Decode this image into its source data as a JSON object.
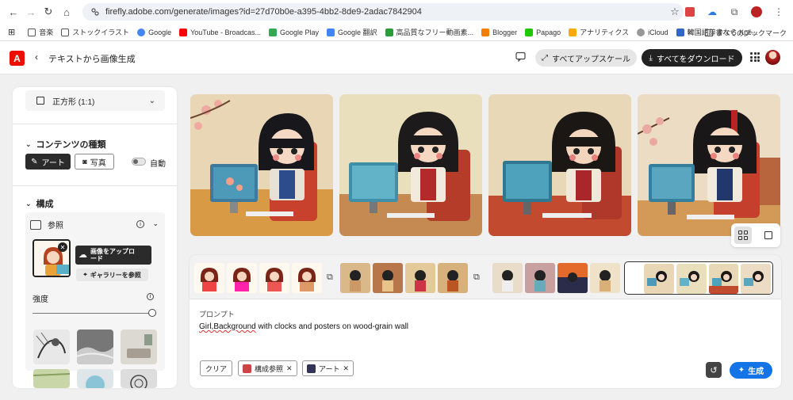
{
  "browser": {
    "url": "firefly.adobe.com/generate/images?id=27d70b0e-a395-4bb2-8de9-2adac7842904",
    "bookmarks": [
      {
        "label": "音楽",
        "color": "#777"
      },
      {
        "label": "ストックイラスト",
        "color": "#777"
      },
      {
        "label": "Google",
        "color": "#4285f4"
      },
      {
        "label": "YouTube - Broadcas...",
        "color": "#ff0000"
      },
      {
        "label": "Google Play",
        "color": "#34a853"
      },
      {
        "label": "Google 翻訳",
        "color": "#4285f4"
      },
      {
        "label": "高品質なフリー動画素...",
        "color": "#2a9d3a"
      },
      {
        "label": "Blogger",
        "color": "#f57d00"
      },
      {
        "label": "Papago",
        "color": "#1ec800"
      },
      {
        "label": "アナリティクス",
        "color": "#f9ab00"
      },
      {
        "label": "iCloud",
        "color": "#999"
      },
      {
        "label": "韓国語辞書なら Kpe...",
        "color": "#3366cc"
      }
    ],
    "bookmarks_more": "»",
    "all_bookmarks": "すべてのブックマーク"
  },
  "header": {
    "back_label": "‹",
    "title": "テキストから画像生成",
    "upscale_all": "すべてアップスケール",
    "download_all": "すべてをダウンロード"
  },
  "left_panel": {
    "aspect_ratio": "正方形 (1:1)",
    "content_type_title": "コンテンツの種類",
    "art_label": "アート",
    "photo_label": "写真",
    "auto_label": "自動",
    "composition_title": "構成",
    "reference_label": "参照",
    "upload_label": "画像をアップロード",
    "gallery_label": "ギャラリーを参照",
    "strength_label": "強度",
    "strength_value": 1.0
  },
  "prompt_panel": {
    "prompt_label": "プロンプト",
    "prompt_text": "Girl,Background with clocks and posters on wood-grain wall",
    "clear_label": "クリア",
    "chip_composition": "構成参照",
    "chip_art": "アート",
    "generate_label": "生成"
  },
  "colors": {
    "accent": "#1473e6",
    "adobe_red": "#eb1000"
  }
}
